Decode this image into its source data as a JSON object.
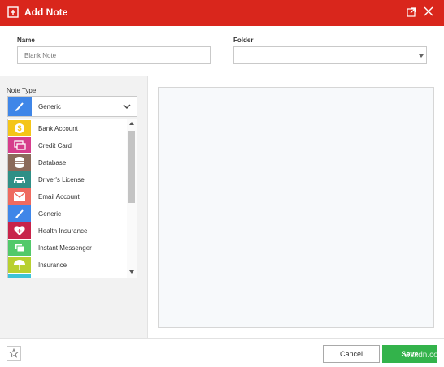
{
  "window": {
    "title": "Add Note",
    "accent_color": "#d9261c"
  },
  "form": {
    "name_label": "Name",
    "name_placeholder": "Blank Note",
    "name_value": "",
    "folder_label": "Folder",
    "folder_value": ""
  },
  "note_type": {
    "label": "Note Type:",
    "selected": "Generic",
    "selected_color": "#3f86e8",
    "selected_icon": "pen-icon",
    "options": [
      {
        "label": "Bank Account",
        "color": "#f4c518",
        "icon": "dollar-coin-icon"
      },
      {
        "label": "Credit Card",
        "color": "#d63d8c",
        "icon": "credit-card-icon"
      },
      {
        "label": "Database",
        "color": "#8b6a5a",
        "icon": "database-icon"
      },
      {
        "label": "Driver's License",
        "color": "#2f8f86",
        "icon": "car-icon"
      },
      {
        "label": "Email Account",
        "color": "#ee6a5f",
        "icon": "envelope-icon"
      },
      {
        "label": "Generic",
        "color": "#3f86e8",
        "icon": "pen-icon"
      },
      {
        "label": "Health Insurance",
        "color": "#c8234a",
        "icon": "heart-plus-icon"
      },
      {
        "label": "Instant Messenger",
        "color": "#52c96a",
        "icon": "chat-icon"
      },
      {
        "label": "Insurance",
        "color": "#b8d030",
        "icon": "umbrella-icon"
      }
    ]
  },
  "footer": {
    "cancel_label": "Cancel",
    "save_label": "Save",
    "save_color": "#33b34b",
    "watermark": "wsxdn.com"
  }
}
